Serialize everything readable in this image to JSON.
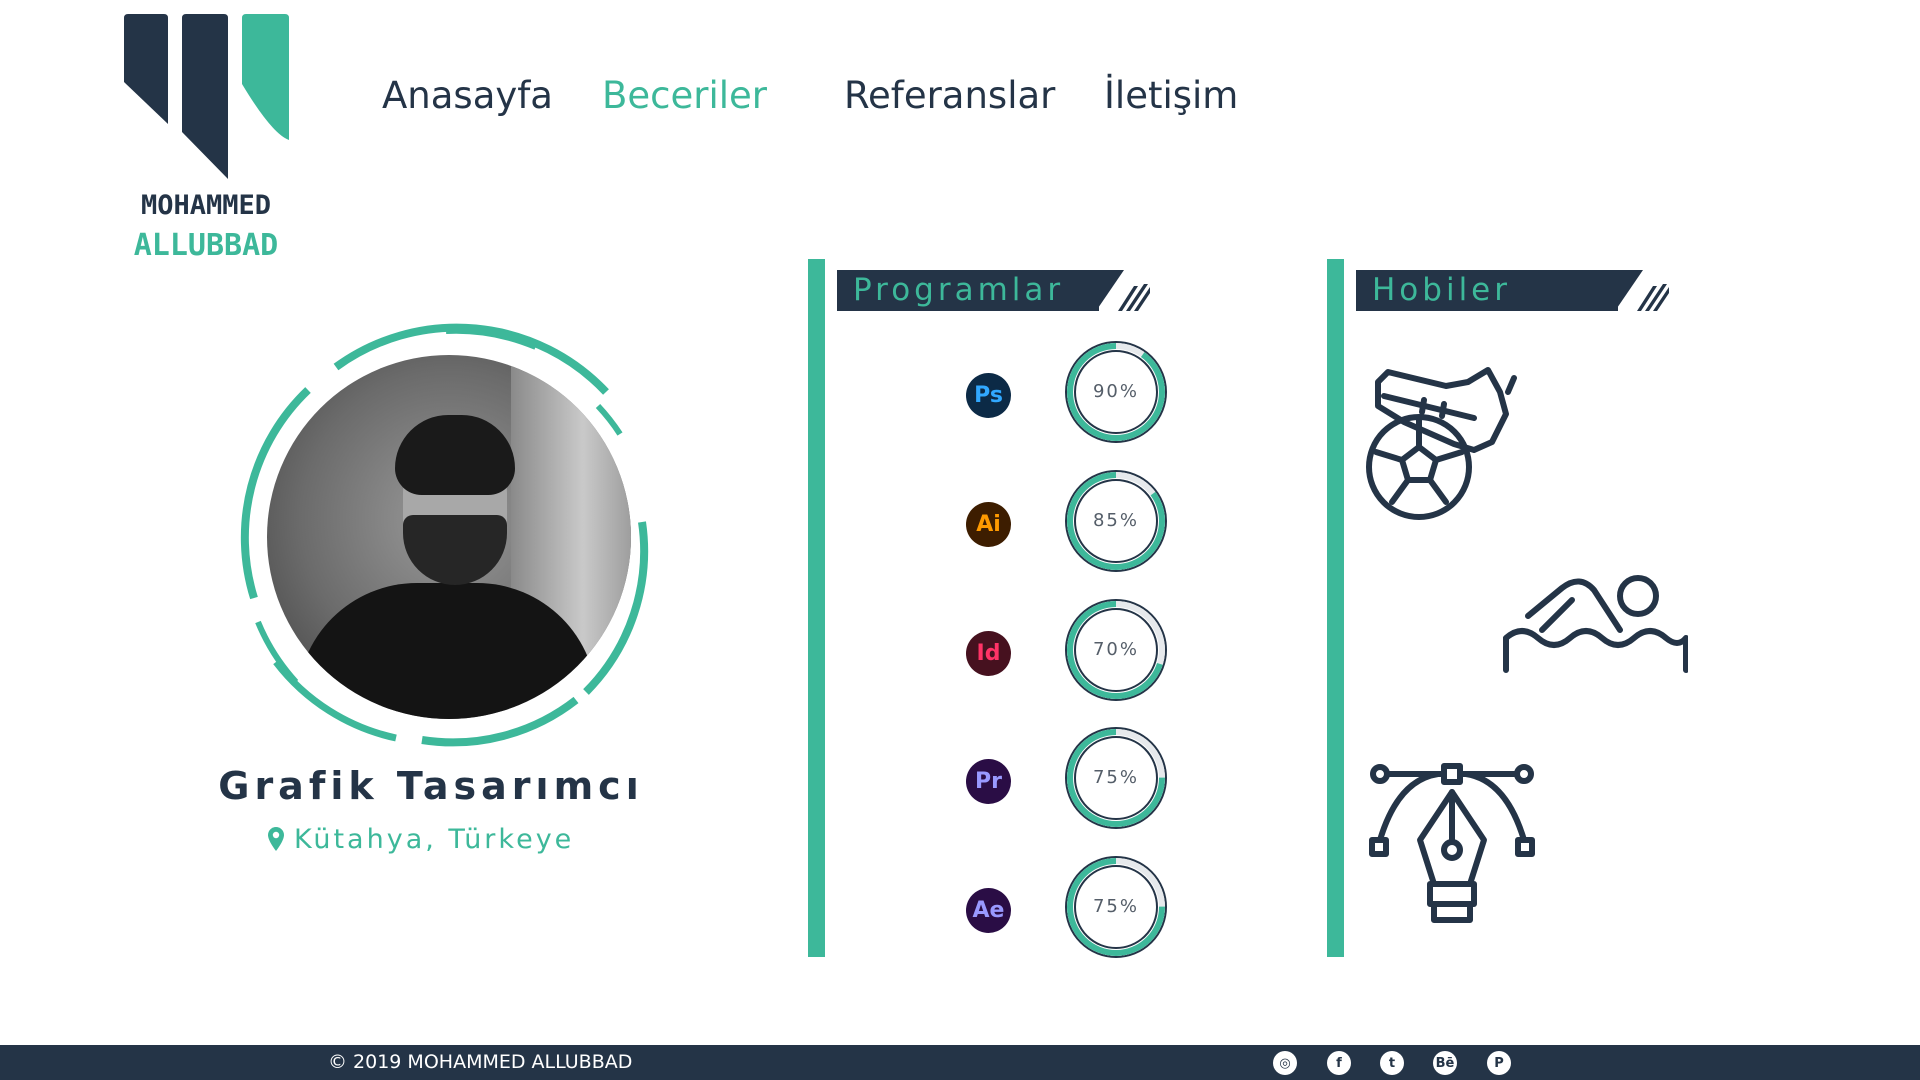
{
  "brand": {
    "line1": "MOHAMMED",
    "line2": "ALLUBBAD",
    "colors": {
      "navy": "#243447",
      "teal": "#3db89a"
    }
  },
  "nav": {
    "items": [
      "Anasayfa",
      "Beceriler",
      "Referanslar",
      "İletişim"
    ],
    "active": "Beceriler"
  },
  "profile": {
    "title": "Grafik Tasarımcı",
    "location": "Kütahya, Türkeye"
  },
  "programs": {
    "heading": "Programlar",
    "items": [
      {
        "icon": "photoshop-icon",
        "abbr": "Ps",
        "percent_label": "90%",
        "level": 0.9,
        "bg": "#0c2a46",
        "fg": "#31a8ff"
      },
      {
        "icon": "illustrator-icon",
        "abbr": "Ai",
        "percent_label": "85%",
        "level": 0.85,
        "bg": "#3d1d00",
        "fg": "#ff9a00"
      },
      {
        "icon": "indesign-icon",
        "abbr": "Id",
        "percent_label": "70%",
        "level": 0.7,
        "bg": "#46111f",
        "fg": "#ff3366"
      },
      {
        "icon": "premiere-icon",
        "abbr": "Pr",
        "percent_label": "75%",
        "level": 0.75,
        "bg": "#2a0d45",
        "fg": "#9999ff"
      },
      {
        "icon": "after-effects-icon",
        "abbr": "Ae",
        "percent_label": "75%",
        "level": 0.75,
        "bg": "#2a0d45",
        "fg": "#9999ff"
      }
    ]
  },
  "hobbies": {
    "heading": "Hobiler",
    "items": [
      "football-icon",
      "swimming-icon",
      "pen-tool-icon"
    ]
  },
  "footer": {
    "copyright": "© 2019 MOHAMMED ALLUBBAD",
    "social": [
      {
        "icon": "instagram-icon",
        "glyph": "◎"
      },
      {
        "icon": "facebook-icon",
        "glyph": "f"
      },
      {
        "icon": "twitter-icon",
        "glyph": "t"
      },
      {
        "icon": "behance-icon",
        "glyph": "Bē"
      },
      {
        "icon": "pinterest-icon",
        "glyph": "P"
      }
    ]
  }
}
